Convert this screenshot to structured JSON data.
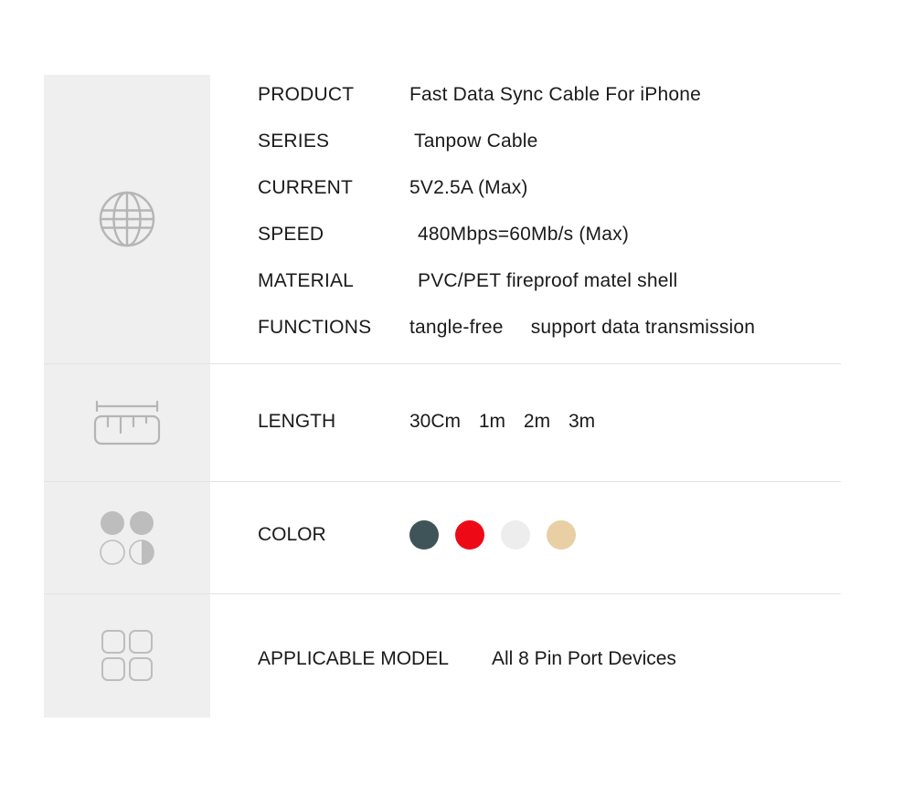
{
  "sheet": {
    "background_color": "#ffffff",
    "rail_color": "#efefef",
    "divider_color": "#e3e3e3",
    "icon_color": "#b5b5b5"
  },
  "rows": {
    "specs": {
      "icon": "globe-icon",
      "lines": [
        {
          "label": "PRODUCT",
          "value": "Fast Data Sync Cable For iPhone"
        },
        {
          "label": "SERIES",
          "value": "Tanpow Cable"
        },
        {
          "label": "CURRENT",
          "value": "5V2.5A  (Max)"
        },
        {
          "label": "SPEED",
          "value": "480Mbps=60Mb/s  (Max)"
        },
        {
          "label": "MATERIAL",
          "value": "PVC/PET fireproof matel shell"
        },
        {
          "label": "FUNCTIONS",
          "value_a": "tangle-free",
          "value_b": "support data transmission"
        }
      ]
    },
    "length": {
      "icon": "ruler-icon",
      "label": "LENGTH",
      "options": [
        "30Cm",
        "1m",
        "2m",
        "3m"
      ]
    },
    "color": {
      "icon": "color-circles-icon",
      "label": "COLOR",
      "swatches": [
        {
          "name": "dark-slate",
          "hex": "#3f5459"
        },
        {
          "name": "red",
          "hex": "#ed0a16"
        },
        {
          "name": "white",
          "hex": "#ededed"
        },
        {
          "name": "gold",
          "hex": "#e8cfa4"
        }
      ]
    },
    "model": {
      "icon": "grid-icon",
      "label": "APPLICABLE MODEL",
      "value": "All 8 Pin Port Devices"
    }
  }
}
